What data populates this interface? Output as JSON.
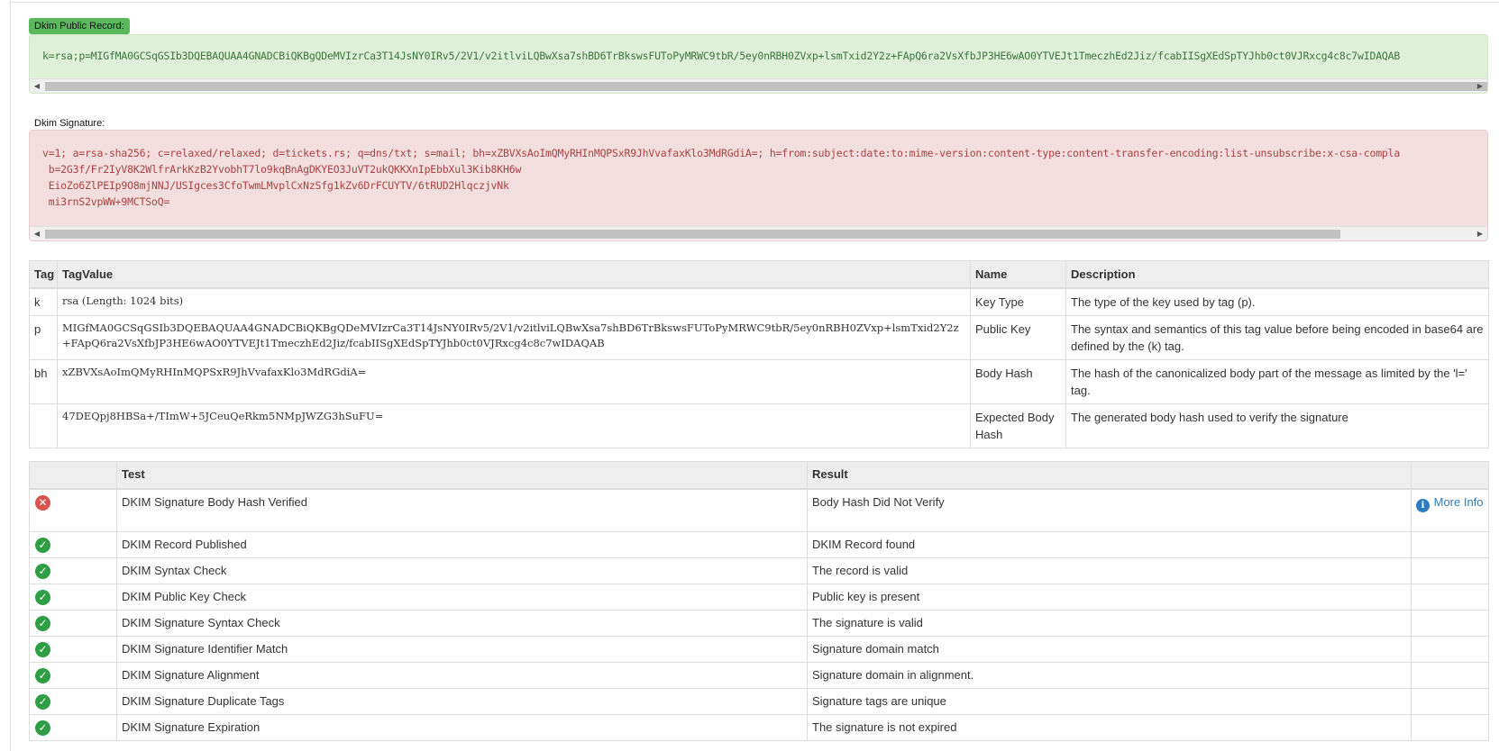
{
  "public_record": {
    "label": "Dkim Public Record:",
    "text": "k=rsa;p=MIGfMA0GCSqGSIb3DQEBAQUAA4GNADCBiQKBgQDeMVIzrCa3T14JsNY0IRv5/2V1/v2itlviLQBwXsa7shBD6TrBkswsFUToPyMRWC9tbR/5ey0nRBH0ZVxp+lsmTxid2Y2z+FApQ6ra2VsXfbJP3HE6wAO0YTVEJt1TmeczhEd2Jiz/fcabIISgXEdSpTYJhb0ct0VJRxcg4c8c7wIDAQAB"
  },
  "signature": {
    "label": "Dkim Signature:",
    "text": "v=1; a=rsa-sha256; c=relaxed/relaxed; d=tickets.rs; q=dns/txt; s=mail; bh=xZBVXsAoImQMyRHInMQPSxR9JhVvafaxKlo3MdRGdiA=; h=from:subject:date:to:mime-version:content-type:content-transfer-encoding:list-unsubscribe:x-csa-compla\n b=2G3f/Fr2IyV8K2WlfrArkKzB2YvobhT7lo9kqBnAgDKYEO3JuVT2ukQKKXnIpEbbXul3Kib8KH6w\n EioZo6ZlPEIp9O8mjNNJ/USIgces3CfoTwmLMvplCxNzSfg1kZv6DrFCUYTV/6tRUD2HlqczjvNk\n mi3rnS2vpWW+9MCTSoQ="
  },
  "tag_table": {
    "headers": {
      "tag": "Tag",
      "value": "TagValue",
      "name": "Name",
      "description": "Description"
    },
    "rows": [
      {
        "tag": "k",
        "value": "rsa (Length: 1024 bits)",
        "name": "Key Type",
        "description": "The type of the key used by tag (p)."
      },
      {
        "tag": "p",
        "value": "MIGfMA0GCSqGSIb3DQEBAQUAA4GNADCBiQKBgQDeMVIzrCa3T14JsNY0IRv5/2V1/v2itlviLQBwXsa7shBD6TrBkswsFUToPyMRWC9tbR/5ey0nRBH0ZVxp+lsmTxid2Y2z+FApQ6ra2VsXfbJP3HE6wAO0YTVEJt1TmeczhEd2Jiz/fcabIISgXEdSpTYJhb0ct0VJRxcg4c8c7wIDAQAB",
        "name": "Public Key",
        "description": "The syntax and semantics of this tag value before being encoded in base64 are defined by the (k) tag."
      },
      {
        "tag": "bh",
        "value": "xZBVXsAoImQMyRHInMQPSxR9JhVvafaxKlo3MdRGdiA=",
        "name": "Body Hash",
        "description": "The hash of the canonicalized body part of the message as limited by the 'l=' tag."
      },
      {
        "tag": "",
        "value": "47DEQpj8HBSa+/TImW+5JCeuQeRkm5NMpJWZG3hSuFU=",
        "name": "Expected Body Hash",
        "description": "The generated body hash used to verify the signature"
      }
    ]
  },
  "test_table": {
    "headers": {
      "status": "",
      "test": "Test",
      "result": "Result",
      "info": ""
    },
    "more_info_label": "More Info",
    "rows": [
      {
        "status": "fail",
        "test": "DKIM Signature Body Hash Verified",
        "result": "Body Hash Did Not Verify",
        "more_info": true
      },
      {
        "status": "ok",
        "test": "DKIM Record Published",
        "result": "DKIM Record found"
      },
      {
        "status": "ok",
        "test": "DKIM Syntax Check",
        "result": "The record is valid"
      },
      {
        "status": "ok",
        "test": "DKIM Public Key Check",
        "result": "Public key is present"
      },
      {
        "status": "ok",
        "test": "DKIM Signature Syntax Check",
        "result": "The signature is valid"
      },
      {
        "status": "ok",
        "test": "DKIM Signature Identifier Match",
        "result": "Signature domain match"
      },
      {
        "status": "ok",
        "test": "DKIM Signature Alignment",
        "result": "Signature domain in alignment."
      },
      {
        "status": "ok",
        "test": "DKIM Signature Duplicate Tags",
        "result": "Signature tags are unique"
      },
      {
        "status": "ok",
        "test": "DKIM Signature Expiration",
        "result": "The signature is not expired"
      }
    ]
  },
  "icons": {
    "ok": "check-circle-icon",
    "fail": "x-circle-icon",
    "info": "info-circle-icon"
  },
  "colors": {
    "success": "#5cb85c",
    "danger": "#d9534f",
    "link": "#2a7bbf",
    "green_bg": "#dff0d8",
    "red_bg": "#f2dede"
  }
}
